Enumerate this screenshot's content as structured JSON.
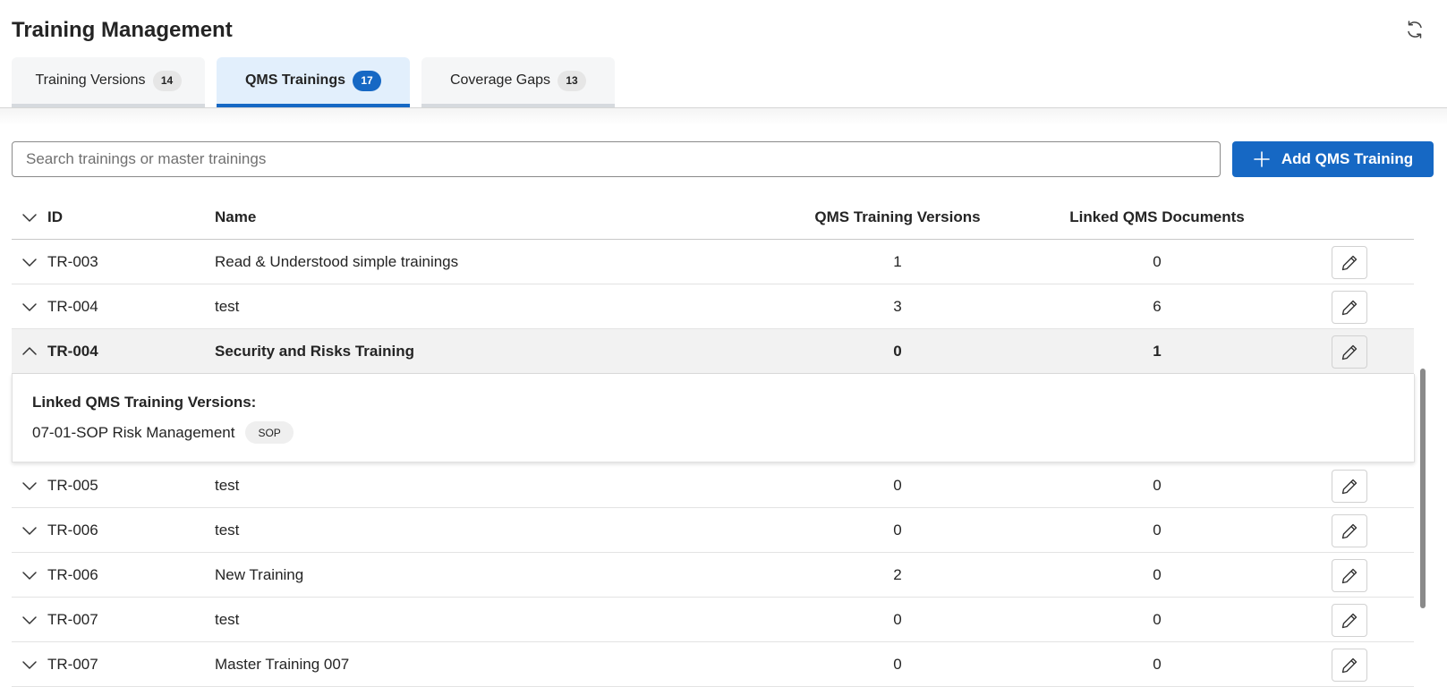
{
  "app": {
    "title": "Training Management"
  },
  "tabs": [
    {
      "label": "Training Versions",
      "count": "14",
      "active": false
    },
    {
      "label": "QMS Trainings",
      "count": "17",
      "active": true
    },
    {
      "label": "Coverage Gaps",
      "count": "13",
      "active": false
    }
  ],
  "search": {
    "placeholder": "Search trainings or master trainings",
    "value": ""
  },
  "add_button": {
    "label": "Add QMS Training"
  },
  "table": {
    "columns": {
      "id": "ID",
      "name": "Name",
      "versions": "QMS Training Versions",
      "documents": "Linked QMS Documents"
    },
    "rows_before": [
      {
        "id": "TR-003",
        "name": "Read & Understood simple trainings",
        "versions": "1",
        "documents": "0"
      },
      {
        "id": "TR-004",
        "name": "test",
        "versions": "3",
        "documents": "6"
      }
    ],
    "expanded_row": {
      "id": "TR-004",
      "name": "Security and Risks Training",
      "versions": "0",
      "documents": "1"
    },
    "expanded_detail": {
      "heading": "Linked QMS Training Versions:",
      "items": [
        {
          "name": "07-01-SOP Risk Management",
          "tag": "SOP"
        }
      ]
    },
    "rows_after": [
      {
        "id": "TR-005",
        "name": "test",
        "versions": "0",
        "documents": "0"
      },
      {
        "id": "TR-006",
        "name": "test",
        "versions": "0",
        "documents": "0"
      },
      {
        "id": "TR-006",
        "name": "New Training",
        "versions": "2",
        "documents": "0"
      },
      {
        "id": "TR-007",
        "name": "test",
        "versions": "0",
        "documents": "0"
      },
      {
        "id": "TR-007",
        "name": "Master Training 007",
        "versions": "0",
        "documents": "0"
      }
    ]
  },
  "icons": {
    "refresh": "refresh-icon",
    "add": "plus-icon",
    "chevron_collapsed": "chevron-down-icon",
    "chevron_expanded": "chevron-up-icon",
    "edit": "pencil-icon"
  },
  "colors": {
    "accent": "#1668c4",
    "active_tab_bg": "#e2effc"
  }
}
